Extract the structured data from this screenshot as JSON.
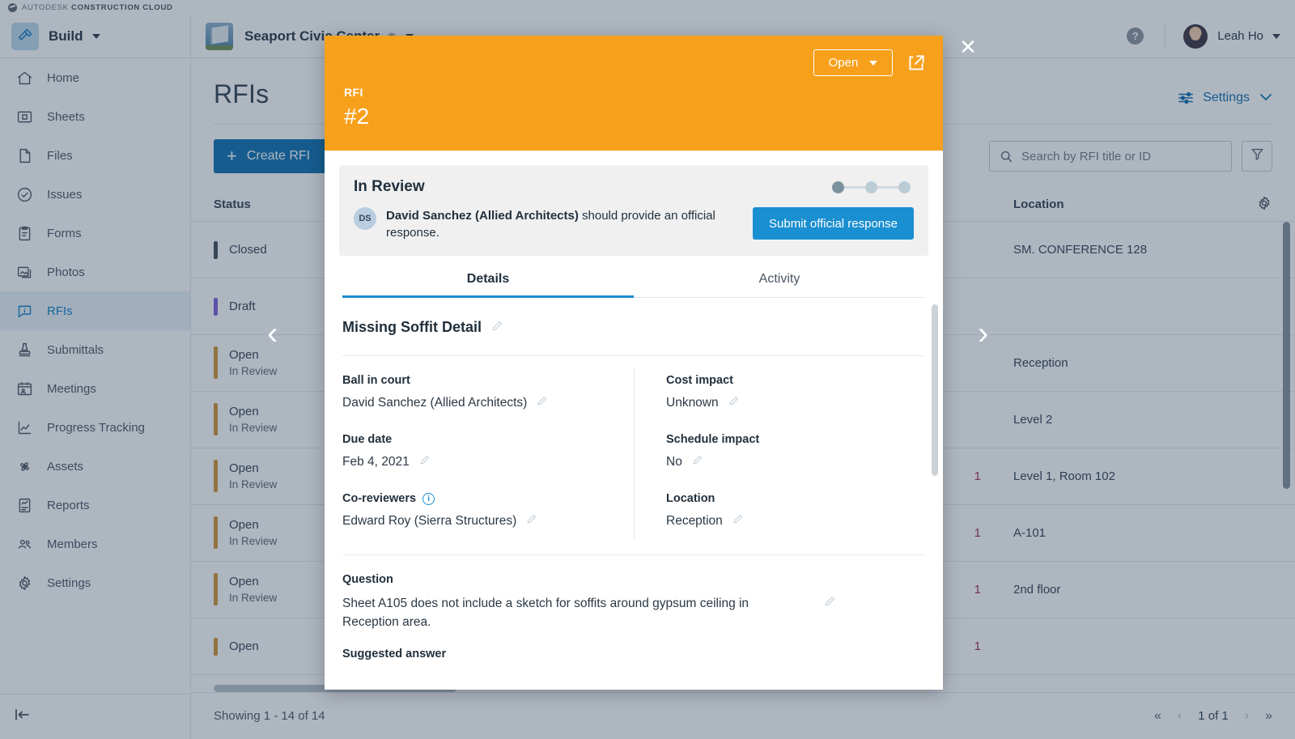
{
  "brand": {
    "text_light": "AUTODESK",
    "text_bold": "CONSTRUCTION CLOUD"
  },
  "topbar": {
    "product": "Build",
    "project": "Seaport Civic Center",
    "help_label": "?",
    "user": "Leah Ho"
  },
  "sidebar": {
    "items": [
      {
        "label": "Home",
        "icon": "home-icon"
      },
      {
        "label": "Sheets",
        "icon": "sheets-icon"
      },
      {
        "label": "Files",
        "icon": "files-icon"
      },
      {
        "label": "Issues",
        "icon": "issues-icon"
      },
      {
        "label": "Forms",
        "icon": "forms-icon"
      },
      {
        "label": "Photos",
        "icon": "photos-icon"
      },
      {
        "label": "RFIs",
        "icon": "rfis-icon"
      },
      {
        "label": "Submittals",
        "icon": "submittals-icon"
      },
      {
        "label": "Meetings",
        "icon": "meetings-icon"
      },
      {
        "label": "Progress Tracking",
        "icon": "progress-tracking-icon"
      },
      {
        "label": "Assets",
        "icon": "assets-icon"
      },
      {
        "label": "Reports",
        "icon": "reports-icon"
      },
      {
        "label": "Members",
        "icon": "members-icon"
      },
      {
        "label": "Settings",
        "icon": "settings-icon"
      }
    ],
    "active_index": 6,
    "collapse_icon": "collapse-sidebar-icon"
  },
  "main": {
    "page_title": "RFIs",
    "settings_label": "Settings",
    "create_label": "Create RFI",
    "search_placeholder": "Search by RFI title or ID",
    "search_value": "",
    "columns": {
      "status": "Status",
      "location": "Location"
    },
    "rows": [
      {
        "status": "Closed",
        "substatus": "",
        "accent": "#3f4b57",
        "mid": "",
        "location": "SM. CONFERENCE 128"
      },
      {
        "status": "Draft",
        "substatus": "",
        "accent": "#7b5ddb",
        "mid": "",
        "location": ""
      },
      {
        "status": "Open",
        "substatus": "In Review",
        "accent": "#d2912f",
        "mid": "",
        "location": "Reception"
      },
      {
        "status": "Open",
        "substatus": "In Review",
        "accent": "#d2912f",
        "mid": "",
        "location": "Level 2"
      },
      {
        "status": "Open",
        "substatus": "In Review",
        "accent": "#d2912f",
        "mid": "1",
        "location": "Level 1, Room 102"
      },
      {
        "status": "Open",
        "substatus": "In Review",
        "accent": "#d2912f",
        "mid": "1",
        "location": "A-101"
      },
      {
        "status": "Open",
        "substatus": "In Review",
        "accent": "#d2912f",
        "mid": "1",
        "location": "2nd floor"
      },
      {
        "status": "Open",
        "substatus": "",
        "accent": "#d2912f",
        "mid": "1",
        "location": ""
      }
    ],
    "footer": {
      "showing": "Showing 1 - 14 of 14",
      "page": "1 of 1",
      "first": "«",
      "prev": "‹",
      "next": "›",
      "last": "»"
    }
  },
  "modal": {
    "close_label": "✕",
    "prev_label": "‹",
    "next_label": "›",
    "banner": {
      "kicker": "RFI",
      "title": "#2",
      "status_select": "Open",
      "share_icon": "share-icon",
      "color": "#f7a01c"
    },
    "status_card": {
      "title": "In Review",
      "avatar_initials": "DS",
      "message_bold": "David Sanchez (Allied Architects)",
      "message_rest": " should provide an official response.",
      "button": "Submit official response",
      "steps_total": 3,
      "steps_done": 1
    },
    "tabs": [
      {
        "label": "Details",
        "active": true
      },
      {
        "label": "Activity",
        "active": false
      }
    ],
    "rfi_title": "Missing Soffit Detail",
    "fields_left": [
      {
        "label": "Ball in court",
        "value": "David Sanchez (Allied Architects)",
        "info": false
      },
      {
        "label": "Due date",
        "value": "Feb 4, 2021",
        "info": false
      },
      {
        "label": "Co-reviewers",
        "value": "Edward Roy (Sierra Structures)",
        "info": true
      }
    ],
    "fields_right": [
      {
        "label": "Cost impact",
        "value": "Unknown",
        "info": false
      },
      {
        "label": "Schedule impact",
        "value": "No",
        "info": false
      },
      {
        "label": "Location",
        "value": "Reception",
        "info": false
      }
    ],
    "question_label": "Question",
    "question_text": "Sheet A105 does not include a sketch for soffits around gypsum ceiling in Reception area.",
    "suggested_answer_label": "Suggested answer"
  },
  "colors": {
    "accent_blue": "#0a6fb0",
    "banner_orange": "#f7a01c",
    "submit_blue": "#1a8fd1",
    "draft_purple": "#7b5ddb",
    "open_amber": "#d2912f",
    "closed_gray": "#3f4b57"
  }
}
